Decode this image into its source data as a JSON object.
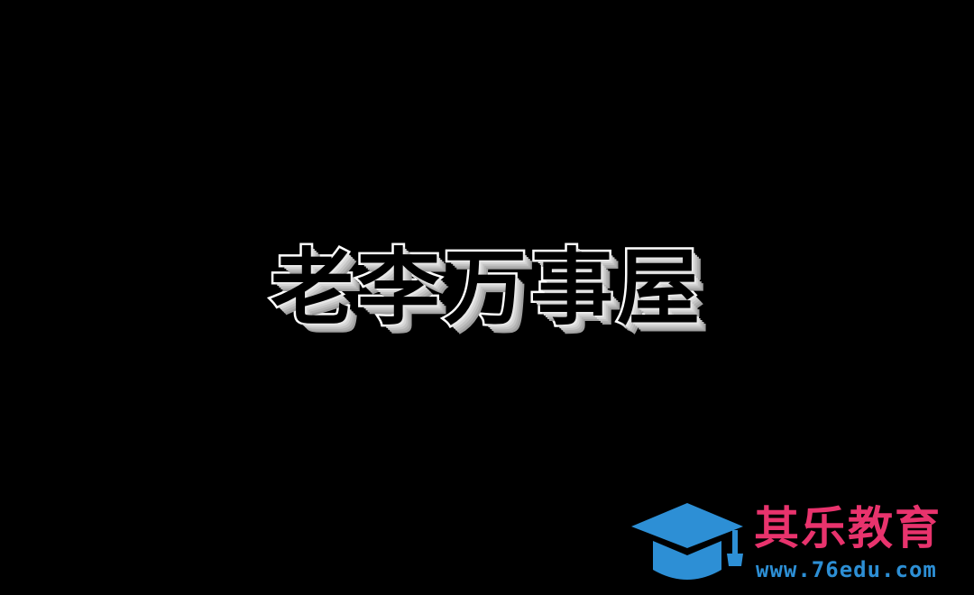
{
  "title": "老李万事屋",
  "logo": {
    "icon": "graduation-cap-icon",
    "name": "其乐教育",
    "url": "www.76edu.com"
  },
  "colors": {
    "background": "#000000",
    "title_fill": "#000000",
    "title_outline": "#ffffff",
    "logo_icon": "#2d8fd5",
    "logo_name": "#e8336d",
    "logo_url": "#2d8fd5"
  }
}
